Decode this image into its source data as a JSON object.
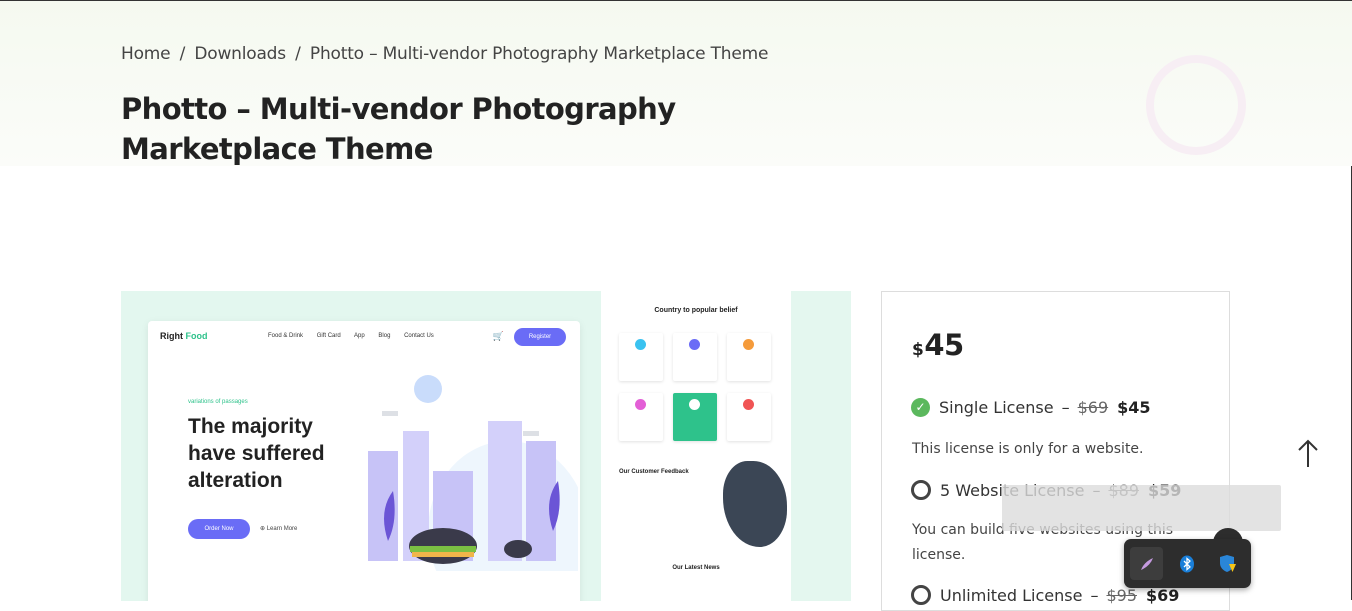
{
  "breadcrumb": {
    "home": "Home",
    "sep1": "/",
    "downloads": "Downloads",
    "sep2": "/",
    "current": "Photto – Multi-vendor Photography Marketplace Theme"
  },
  "page_title": "Photto – Multi-vendor Photography Marketplace Theme",
  "preview": {
    "logo_a": "Right",
    "logo_b": "Food",
    "nav": [
      "Food & Drink",
      "Gift Card",
      "App",
      "Blog",
      "Contact Us"
    ],
    "register": "Register",
    "eyebrow": "variations of passages",
    "headline": "The majority have suffered alteration",
    "order_button": "Order Now",
    "learn_more": "Learn More",
    "right_title": "Country to popular belief",
    "feedback_title": "Our Customer Feedback",
    "news_title": "Our Latest News"
  },
  "pricing": {
    "currency": "$",
    "amount": "45",
    "licenses": [
      {
        "name": "Single License",
        "dash": "–",
        "old": "$69",
        "new": "$45",
        "selected": true,
        "desc": "This license is only for a website."
      },
      {
        "name": "5 Website License",
        "dash": "–",
        "old": "$89",
        "new": "$59",
        "selected": false,
        "desc": "You can build five websites using this license."
      },
      {
        "name": "Unlimited License",
        "dash": "–",
        "old": "$95",
        "new": "$69",
        "selected": false,
        "desc": ""
      }
    ]
  },
  "icons": {
    "check": "check-circle-icon",
    "scroll_top": "arrow-up-icon",
    "tray": [
      "pen-icon",
      "bluetooth-icon",
      "security-warning-icon"
    ]
  },
  "colors": {
    "accent_purple": "#6a6cf6",
    "accent_green": "#2ec28b",
    "check_green": "#5bb85d"
  }
}
